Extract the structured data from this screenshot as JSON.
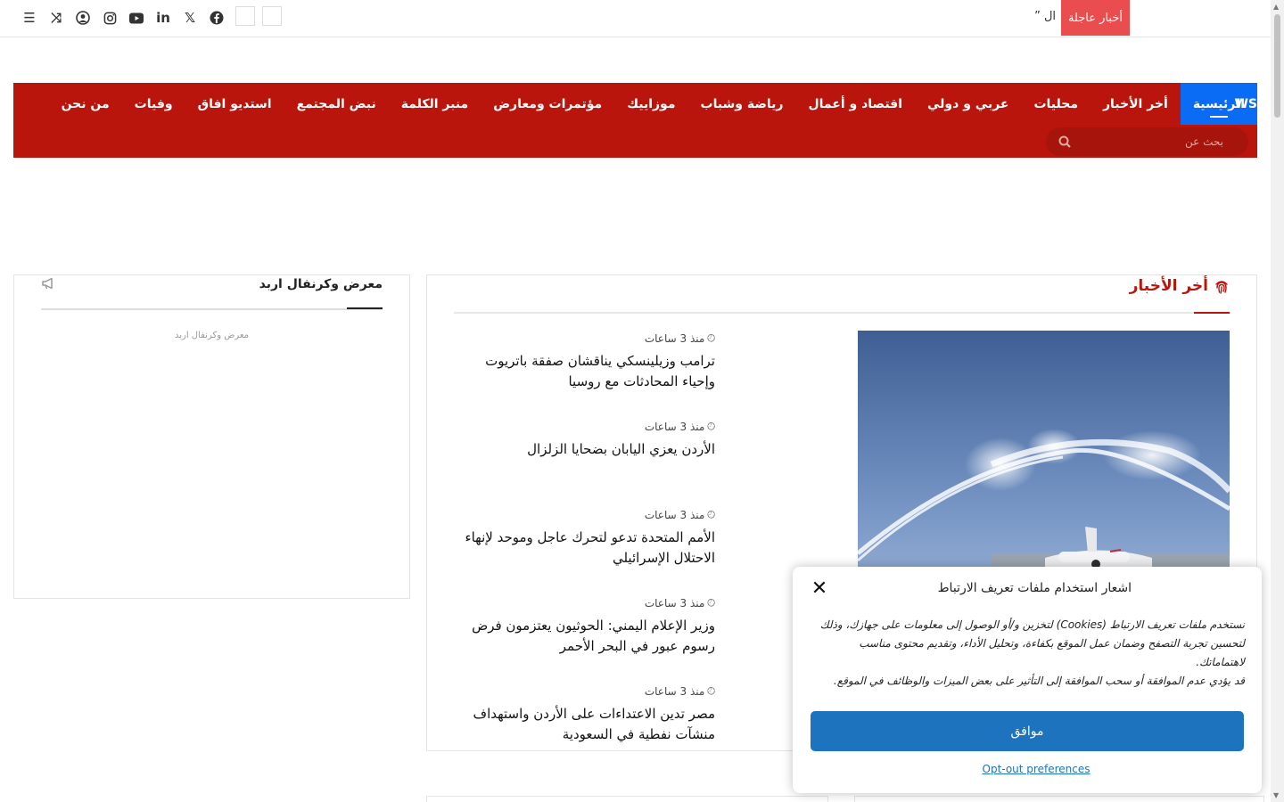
{
  "topbar": {
    "icons": [
      "menu-icon",
      "shuffle-icon",
      "user-icon",
      "instagram-icon",
      "youtube-icon",
      "linkedin-icon",
      "x-icon",
      "facebook-icon"
    ],
    "breaking_label": "أخبار عاجلة",
    "breaking_text": "” ال"
  },
  "nav": {
    "items": [
      "الرئيسية",
      "أخر الأخبار",
      "محليات",
      "عربي و دولي",
      "اقتصاد و أعمال",
      "رياضة وشباب",
      "موزاييك",
      "مؤتمرات ومعارض",
      "منبر الكلمة",
      "نبض المجتمع",
      "استديو افاق",
      "وفيات",
      "من نحن"
    ],
    "cut_item": "WS",
    "search_placeholder": "بحث عن"
  },
  "sidebar": {
    "title": "معرض وكرنفال اربد",
    "caption": "معرض وكرنفال اربد"
  },
  "news": {
    "title": "أخر الأخبار",
    "stories": [
      {
        "time": "منذ 3 ساعات",
        "headline": "ترامب وزيلينسكي يناقشان صفقة باتريوت وإحياء المحادثات مع روسيا"
      },
      {
        "time": "منذ 3 ساعات",
        "headline": "الأردن يعزي اليابان بضحايا الزلزال"
      },
      {
        "time": "منذ 3 ساعات",
        "headline": "الأمم المتحدة تدعو لتحرك عاجل وموحد لإنهاء الاحتلال الإسرائيلي"
      },
      {
        "time": "منذ 3 ساعات",
        "headline": "وزير الإعلام اليمني: الحوثيون يعتزمون فرض رسوم عبور في البحر الأحمر"
      },
      {
        "time": "منذ 3 ساعات",
        "headline": "مصر تدين الاعتداءات على الأردن واستهداف منشآت نفطية في السعودية"
      }
    ]
  },
  "cookie": {
    "title": "اشعار استخدام ملفات تعريف الارتباط",
    "body_line1": "نستخدم ملفات تعريف الارتباط (Cookies) لتخزين و/أو الوصول إلى معلومات على جهازك، وذلك لتحسين تجربة التصفح وضمان عمل الموقع بكفاءة، وتحليل الأداء، وتقديم محتوى مناسب لاهتماماتك.",
    "body_line2": "قد يؤدي عدم الموافقة أو سحب الموافقة إلى التأثير على بعض الميزات والوظائف في الموقع.",
    "accept": "موافق",
    "optout": "Opt-out preferences"
  },
  "colors": {
    "brand_red": "#b9150c",
    "active_blue": "#0a6cf5",
    "breaking_red": "#e94d4d",
    "accept_blue": "#1e73be"
  }
}
